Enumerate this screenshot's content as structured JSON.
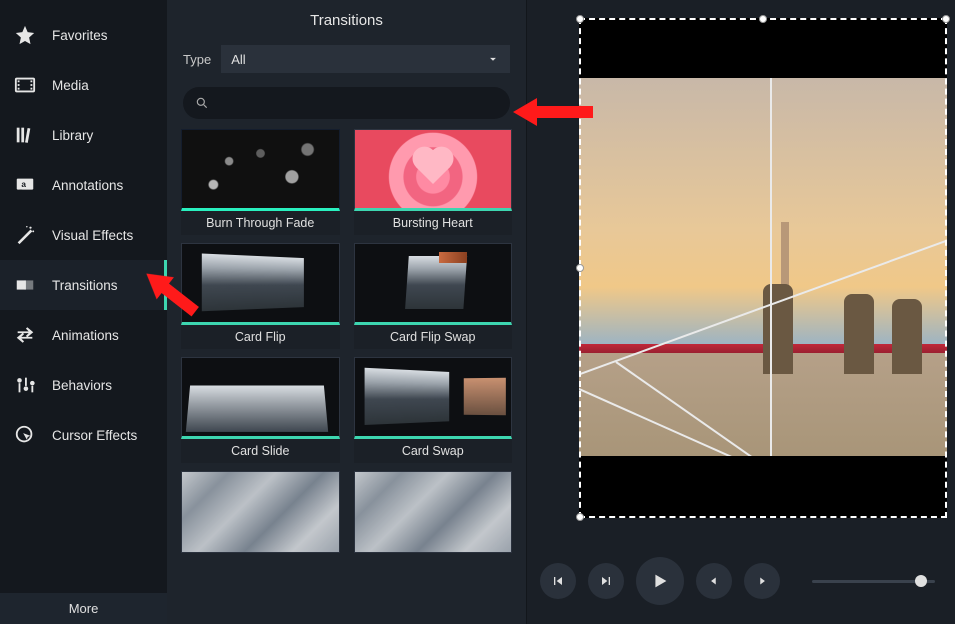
{
  "sidebar": {
    "items": [
      {
        "label": "Favorites",
        "name": "sidebar-item-favorites",
        "icon": "star"
      },
      {
        "label": "Media",
        "name": "sidebar-item-media",
        "icon": "filmstrip"
      },
      {
        "label": "Library",
        "name": "sidebar-item-library",
        "icon": "library"
      },
      {
        "label": "Annotations",
        "name": "sidebar-item-annotations",
        "icon": "annotation"
      },
      {
        "label": "Visual Effects",
        "name": "sidebar-item-visual-effects",
        "icon": "wand"
      },
      {
        "label": "Transitions",
        "name": "sidebar-item-transitions",
        "icon": "transition",
        "selected": true
      },
      {
        "label": "Animations",
        "name": "sidebar-item-animations",
        "icon": "swap"
      },
      {
        "label": "Behaviors",
        "name": "sidebar-item-behaviors",
        "icon": "sliders"
      },
      {
        "label": "Cursor Effects",
        "name": "sidebar-item-cursor-effects",
        "icon": "cursor"
      }
    ],
    "more": "More"
  },
  "panel": {
    "title": "Transitions",
    "type_label": "Type",
    "type_value": "All",
    "search_placeholder": "",
    "transitions": [
      {
        "label": "Burn Through Fade",
        "thumb": "burn-through",
        "accent": true
      },
      {
        "label": "Bursting Heart",
        "thumb": "bursting-heart",
        "accent": true
      },
      {
        "label": "Card Flip",
        "thumb": "card-flip",
        "accent": true
      },
      {
        "label": "Card Flip Swap",
        "thumb": "card-flip-swap",
        "accent": true
      },
      {
        "label": "Card Slide",
        "thumb": "card-slide",
        "accent": true
      },
      {
        "label": "Card Swap",
        "thumb": "card-swap",
        "accent": true
      },
      {
        "label": "",
        "thumb": "geo",
        "accent": false
      },
      {
        "label": "",
        "thumb": "geo",
        "accent": false
      }
    ]
  },
  "colors": {
    "accent": "#3dd6b0",
    "arrow": "#ff1a1a",
    "panel_bg": "#1e242c",
    "sidebar_bg": "#14181e"
  }
}
